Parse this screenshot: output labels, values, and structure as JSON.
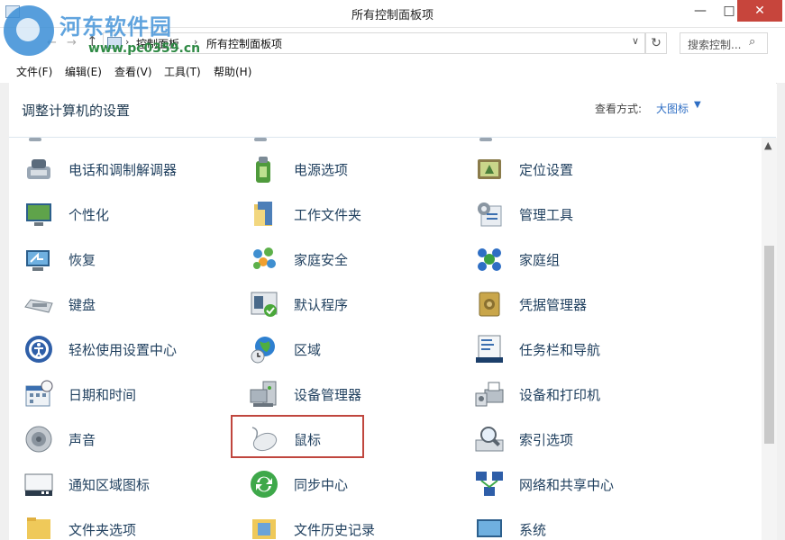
{
  "window": {
    "title": "所有控制面板项",
    "minimize": "—",
    "maximize": "□",
    "close": "✕"
  },
  "watermark": {
    "text": "河东软件园",
    "url": "www.pc0359.cn"
  },
  "nav": {
    "back": "←",
    "forward": "→",
    "up": "↑",
    "crumbs": [
      "控制面板",
      "所有控制面板项"
    ],
    "separator": "›",
    "dropdown": "∨",
    "refresh": "↻",
    "search_placeholder": "搜索控制...",
    "search_icon": "⌕"
  },
  "menu": [
    "文件(F)",
    "编辑(E)",
    "查看(V)",
    "工具(T)",
    "帮助(H)"
  ],
  "header": {
    "title": "调整计算机的设置",
    "view_by_label": "查看方式:",
    "view_by_value": "大图标",
    "caret": "▼"
  },
  "items": [
    {
      "label": "电话和调制解调器",
      "icon": "phone-modem-icon"
    },
    {
      "label": "电源选项",
      "icon": "power-options-icon"
    },
    {
      "label": "定位设置",
      "icon": "location-settings-icon"
    },
    {
      "label": "个性化",
      "icon": "personalization-icon"
    },
    {
      "label": "工作文件夹",
      "icon": "work-folders-icon"
    },
    {
      "label": "管理工具",
      "icon": "admin-tools-icon"
    },
    {
      "label": "恢复",
      "icon": "recovery-icon"
    },
    {
      "label": "家庭安全",
      "icon": "family-safety-icon"
    },
    {
      "label": "家庭组",
      "icon": "homegroup-icon"
    },
    {
      "label": "键盘",
      "icon": "keyboard-icon"
    },
    {
      "label": "默认程序",
      "icon": "default-programs-icon"
    },
    {
      "label": "凭据管理器",
      "icon": "credential-manager-icon"
    },
    {
      "label": "轻松使用设置中心",
      "icon": "ease-of-access-icon"
    },
    {
      "label": "区域",
      "icon": "region-icon"
    },
    {
      "label": "任务栏和导航",
      "icon": "taskbar-navigation-icon"
    },
    {
      "label": "日期和时间",
      "icon": "date-time-icon"
    },
    {
      "label": "设备管理器",
      "icon": "device-manager-icon"
    },
    {
      "label": "设备和打印机",
      "icon": "devices-printers-icon"
    },
    {
      "label": "声音",
      "icon": "sound-icon"
    },
    {
      "label": "鼠标",
      "icon": "mouse-icon"
    },
    {
      "label": "索引选项",
      "icon": "indexing-options-icon"
    },
    {
      "label": "通知区域图标",
      "icon": "notification-area-icon"
    },
    {
      "label": "同步中心",
      "icon": "sync-center-icon"
    },
    {
      "label": "网络和共享中心",
      "icon": "network-sharing-icon"
    },
    {
      "label": "文件夹选项",
      "icon": "folder-options-icon"
    },
    {
      "label": "文件历史记录",
      "icon": "file-history-icon"
    },
    {
      "label": "系统",
      "icon": "system-icon"
    }
  ],
  "scrollbar": {
    "up": "▲"
  },
  "colors": {
    "accent": "#2e6ec4",
    "highlight_border": "#c0463e",
    "close_button": "#c7453c",
    "label_text": "#1f3f5e"
  }
}
